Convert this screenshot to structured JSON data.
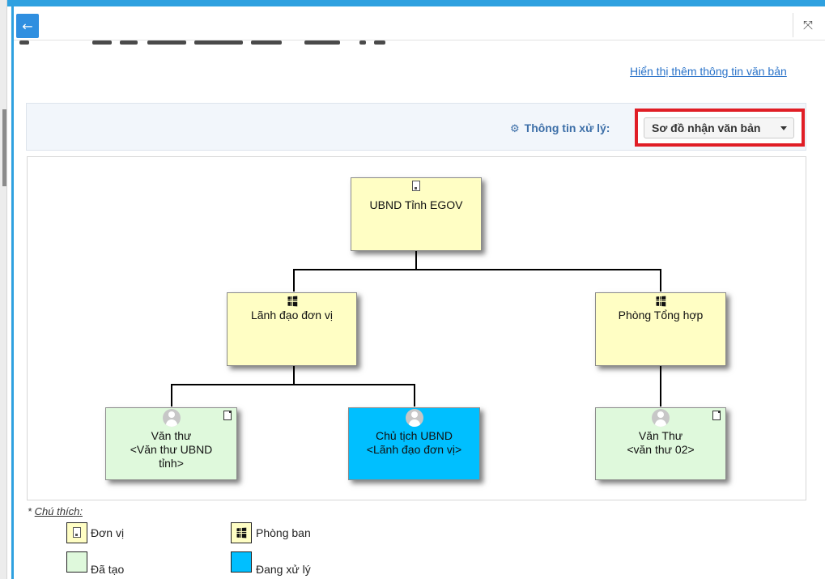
{
  "header": {
    "back_icon": "arrow-left-icon",
    "close_icon": "expand-collapse-icon"
  },
  "links": {
    "more_info": "Hiển thị thêm thông tin văn bản"
  },
  "info_bar": {
    "label": "Thông tin xử lý:",
    "label_icon": "gears-icon",
    "dropdown_value": "Sơ đồ nhận văn bản"
  },
  "diagram": {
    "nodes": {
      "root": {
        "type": "unit",
        "icon": "building-icon",
        "label": "UBND Tỉnh EGOV"
      },
      "dept_left": {
        "type": "department",
        "icon": "windows-icon",
        "label": "Lãnh đạo đơn vị"
      },
      "dept_right": {
        "type": "department",
        "icon": "windows-icon",
        "label": "Phòng Tổng hợp"
      },
      "leaf1": {
        "status": "created",
        "icon": "user-icon",
        "badge": "document-icon",
        "line1": "Văn thư",
        "line2": "<Văn thư UBND",
        "line3": "tỉnh>"
      },
      "leaf2": {
        "status": "processing",
        "icon": "user-icon",
        "line1": "Chủ tịch UBND",
        "line2": "<Lãnh đạo đơn vị>"
      },
      "leaf3": {
        "status": "created",
        "icon": "user-icon",
        "badge": "document-icon",
        "line1": "Văn Thư",
        "line2": "<văn thư 02>"
      }
    }
  },
  "legend": {
    "title_prefix": "* ",
    "title": "Chú thích:",
    "items": [
      {
        "label": "Đơn vị",
        "color": "#fffec4",
        "icon": "building-icon"
      },
      {
        "label": "Phòng ban",
        "color": "#fffec4",
        "icon": "windows-icon"
      },
      {
        "label": "Đã tạo",
        "color": "#dff9dc"
      },
      {
        "label": "Đang xử lý",
        "color": "#00bfff"
      }
    ]
  },
  "colors": {
    "accent": "#2fa1e0",
    "highlight_border": "#e01e26",
    "link": "#2a73c9",
    "unit_fill": "#fffec4",
    "created_fill": "#dff9dc",
    "processing_fill": "#00bfff"
  }
}
